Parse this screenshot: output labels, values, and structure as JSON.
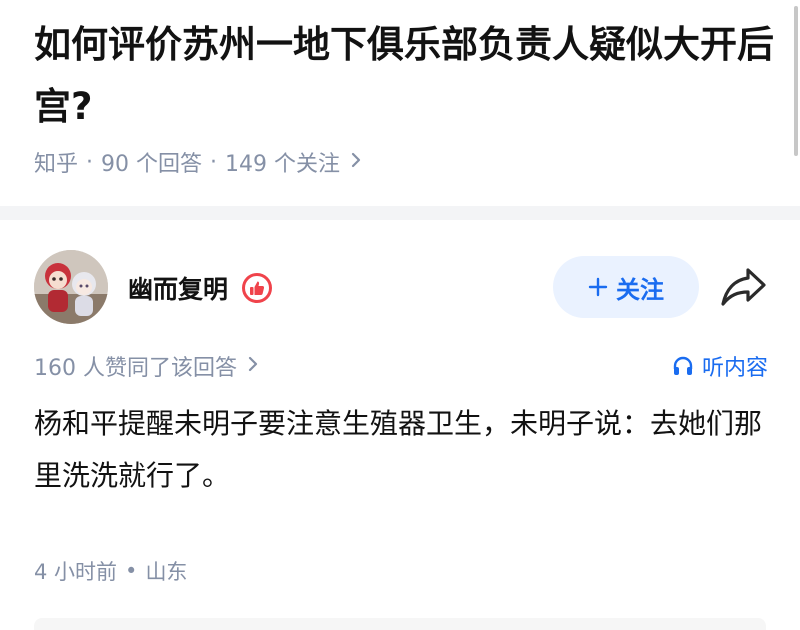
{
  "question": {
    "title": "如何评价苏州一地下俱乐部负责人疑似大开后宫?",
    "source": "知乎",
    "answers_count": "90 个回答",
    "followers_count": "149 个关注",
    "separator": "·"
  },
  "answer": {
    "author_name": "幽而复明",
    "follow_label": "关注",
    "likes_text": "160 人赞同了该回答",
    "listen_label": "听内容",
    "content": "杨和平提醒未明子要注意生殖器卫生，未明子说：去她们那里洗洗就行了。",
    "time": "4 小时前",
    "location": "山东",
    "separator": "•"
  },
  "colors": {
    "accent": "#1a6cf0",
    "follow_bg": "#eaf2ff",
    "muted": "#8590a6",
    "badge": "#f0434b"
  },
  "icons": [
    "chevron-right-icon",
    "plus-icon",
    "share-icon",
    "headphones-icon",
    "thumbs-up-badge-icon"
  ]
}
